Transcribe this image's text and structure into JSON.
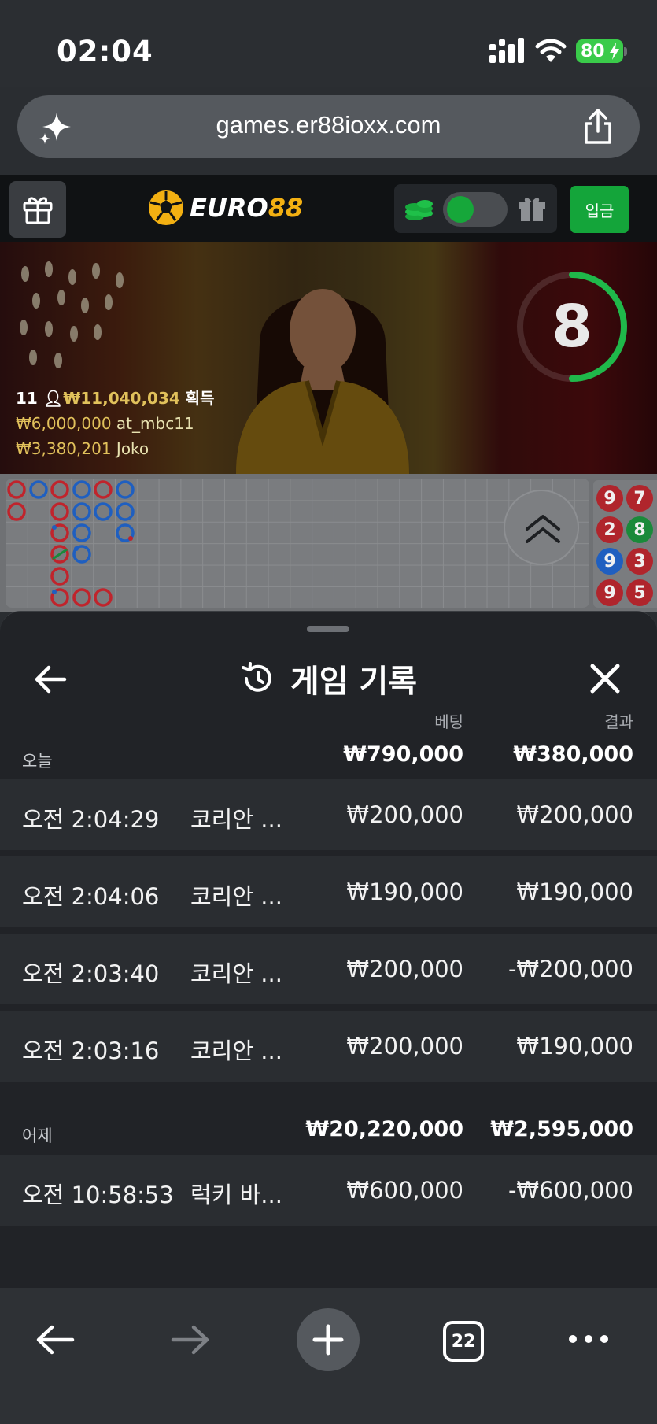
{
  "status_bar": {
    "time": "02:04",
    "battery": "80"
  },
  "browser": {
    "url": "games.er88ioxx.com",
    "tab_count": "22"
  },
  "site": {
    "logo_part1": "EURO",
    "logo_part2": "88",
    "deposit_label": "입금",
    "brand_color": "#f3b012",
    "accent_green": "#14a53a"
  },
  "video": {
    "countdown": "8",
    "countdown_fraction": 0.5,
    "winners_count": "11",
    "winners_total": "₩11,040,034",
    "winners_suffix": "획득",
    "winners": [
      {
        "amount": "₩6,000,000",
        "user": "at_mbc11"
      },
      {
        "amount": "₩3,380,201",
        "user": "Joko"
      }
    ]
  },
  "side_road": [
    "9",
    "7",
    "2",
    "8",
    "9",
    "3",
    "9",
    "5"
  ],
  "history": {
    "title": "게임 기록",
    "col_bet": "베팅",
    "col_result": "결과",
    "groups": [
      {
        "label": "오늘",
        "bet_total": "₩790,000",
        "result_total": "₩380,000",
        "rows": [
          {
            "time": "오전 2:04:29",
            "game": "코리안 ...",
            "bet": "₩200,000",
            "result": "₩200,000"
          },
          {
            "time": "오전 2:04:06",
            "game": "코리안 ...",
            "bet": "₩190,000",
            "result": "₩190,000"
          },
          {
            "time": "오전 2:03:40",
            "game": "코리안 ...",
            "bet": "₩200,000",
            "result": "-₩200,000"
          },
          {
            "time": "오전 2:03:16",
            "game": "코리안 ...",
            "bet": "₩200,000",
            "result": "₩190,000"
          }
        ]
      },
      {
        "label": "어제",
        "bet_total": "₩20,220,000",
        "result_total": "₩2,595,000",
        "rows": [
          {
            "time": "오전 10:58:53",
            "game": "럭키 바...",
            "bet": "₩600,000",
            "result": "-₩600,000"
          }
        ]
      }
    ]
  },
  "icons": {
    "url_left": "sparkle-icon",
    "url_right": "share-icon",
    "header_left": "gift-box-icon",
    "header_chips": "coins-icon",
    "header_gift": "gift-icon",
    "sheet_back": "arrow-left-icon",
    "sheet_title": "history-icon",
    "sheet_close": "close-icon",
    "roadmap_toggle": "chevron-double-up-icon",
    "toolbar": [
      "arrow-left-icon",
      "arrow-right-icon",
      "plus-icon",
      "tabs-icon",
      "more-icon"
    ]
  }
}
